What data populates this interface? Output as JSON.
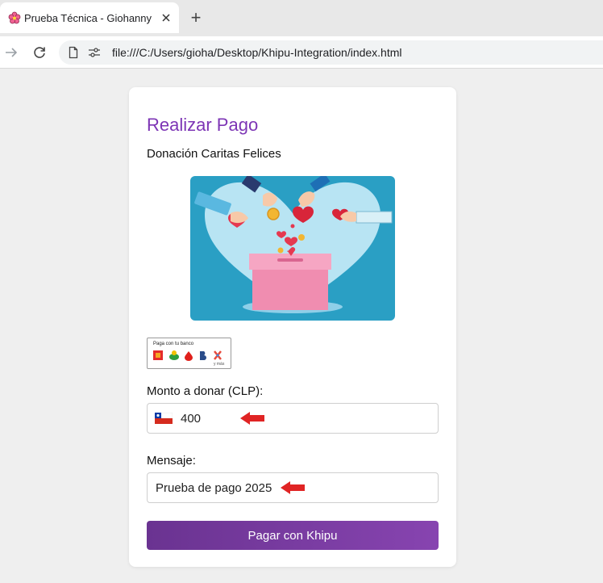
{
  "browser": {
    "tab_title": "Prueba Técnica - Giohanny",
    "new_tab_symbol": "+",
    "url": "file:///C:/Users/gioha/Desktop/Khipu-Integration/index.html"
  },
  "page": {
    "title": "Realizar Pago",
    "subtitle": "Donación Caritas Felices",
    "bank_badge": {
      "title": "Paga con tu banco",
      "more": "y más"
    },
    "amount": {
      "label": "Monto a donar (CLP):",
      "value": "400",
      "flag_icon": "chile-flag-icon"
    },
    "message": {
      "label": "Mensaje:",
      "value": "Prueba de pago 2025"
    },
    "submit_label": "Pagar con Khipu"
  },
  "colors": {
    "title": "#7d35b5",
    "button_start": "#6a3391",
    "button_end": "#8744b0",
    "arrow": "#e02424",
    "hero_bg": "#2a9fc4"
  }
}
